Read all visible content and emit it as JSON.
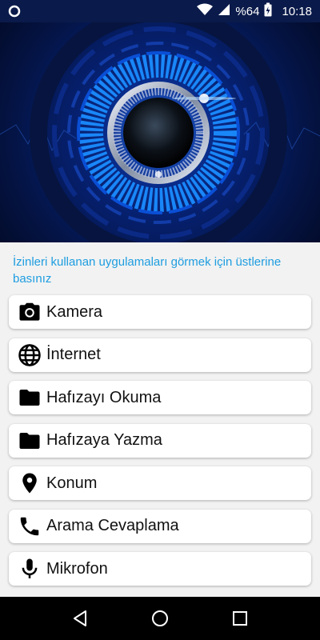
{
  "status_bar": {
    "battery_text": "%64",
    "time": "10:18"
  },
  "hint_text": "İzinleri kullanan uygulamaları görmek için üstlerine basınız",
  "permissions": [
    {
      "label": "Kamera",
      "icon": "camera-icon"
    },
    {
      "label": "İnternet",
      "icon": "globe-icon"
    },
    {
      "label": "Hafızayı Okuma",
      "icon": "folder-icon"
    },
    {
      "label": "Hafızaya Yazma",
      "icon": "folder-icon"
    },
    {
      "label": "Konum",
      "icon": "location-pin-icon"
    },
    {
      "label": "Arama Cevaplama",
      "icon": "phone-icon"
    },
    {
      "label": "Mikrofon",
      "icon": "microphone-icon"
    }
  ],
  "colors": {
    "hint": "#1e9de0",
    "card_background": "#ffffff",
    "page_background": "#f2f2f2",
    "status_bar": "#0a1a4a",
    "nav_bar": "#000000"
  },
  "nav": {
    "back": "back-triangle-icon",
    "home": "home-circle-icon",
    "recents": "recents-square-icon"
  }
}
